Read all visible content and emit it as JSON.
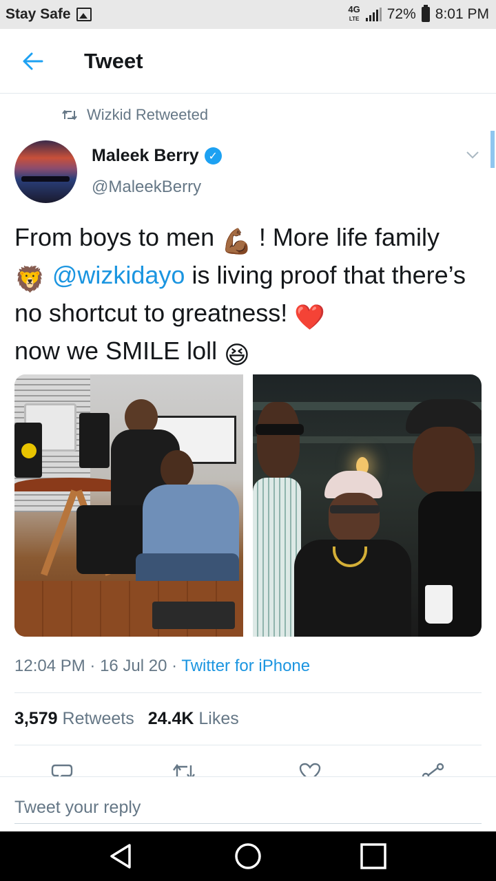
{
  "status_bar": {
    "carrier": "Stay Safe",
    "network": "4G",
    "network_sub": "LTE",
    "battery": "72%",
    "time": "8:01 PM"
  },
  "header": {
    "title": "Tweet"
  },
  "retweet": {
    "text": "Wizkid Retweeted"
  },
  "author": {
    "name": "Maleek Berry",
    "handle": "@MaleekBerry",
    "verified": true
  },
  "tweet": {
    "part1": "From boys to men ",
    "emoji1": "💪🏾",
    "part2": " ! More life family",
    "emoji2": "🦁",
    "mention": "@wizkidayo",
    "part3": " is living proof that there’s no shortcut to greatness! ",
    "emoji3": "❤️",
    "part4": "now we SMILE loll ",
    "emoji4": "😆"
  },
  "meta": {
    "time": "12:04 PM",
    "sep1": " · ",
    "date": "16 Jul 20",
    "sep2": " · ",
    "source": "Twitter for iPhone"
  },
  "stats": {
    "retweets_count": "3,579",
    "retweets_label": "Retweets",
    "likes_count": "24.4K",
    "likes_label": "Likes"
  },
  "reply": {
    "placeholder": "Tweet your reply"
  },
  "colors": {
    "accent": "#1da1f2",
    "link": "#1b95e0",
    "muted": "#657786"
  }
}
